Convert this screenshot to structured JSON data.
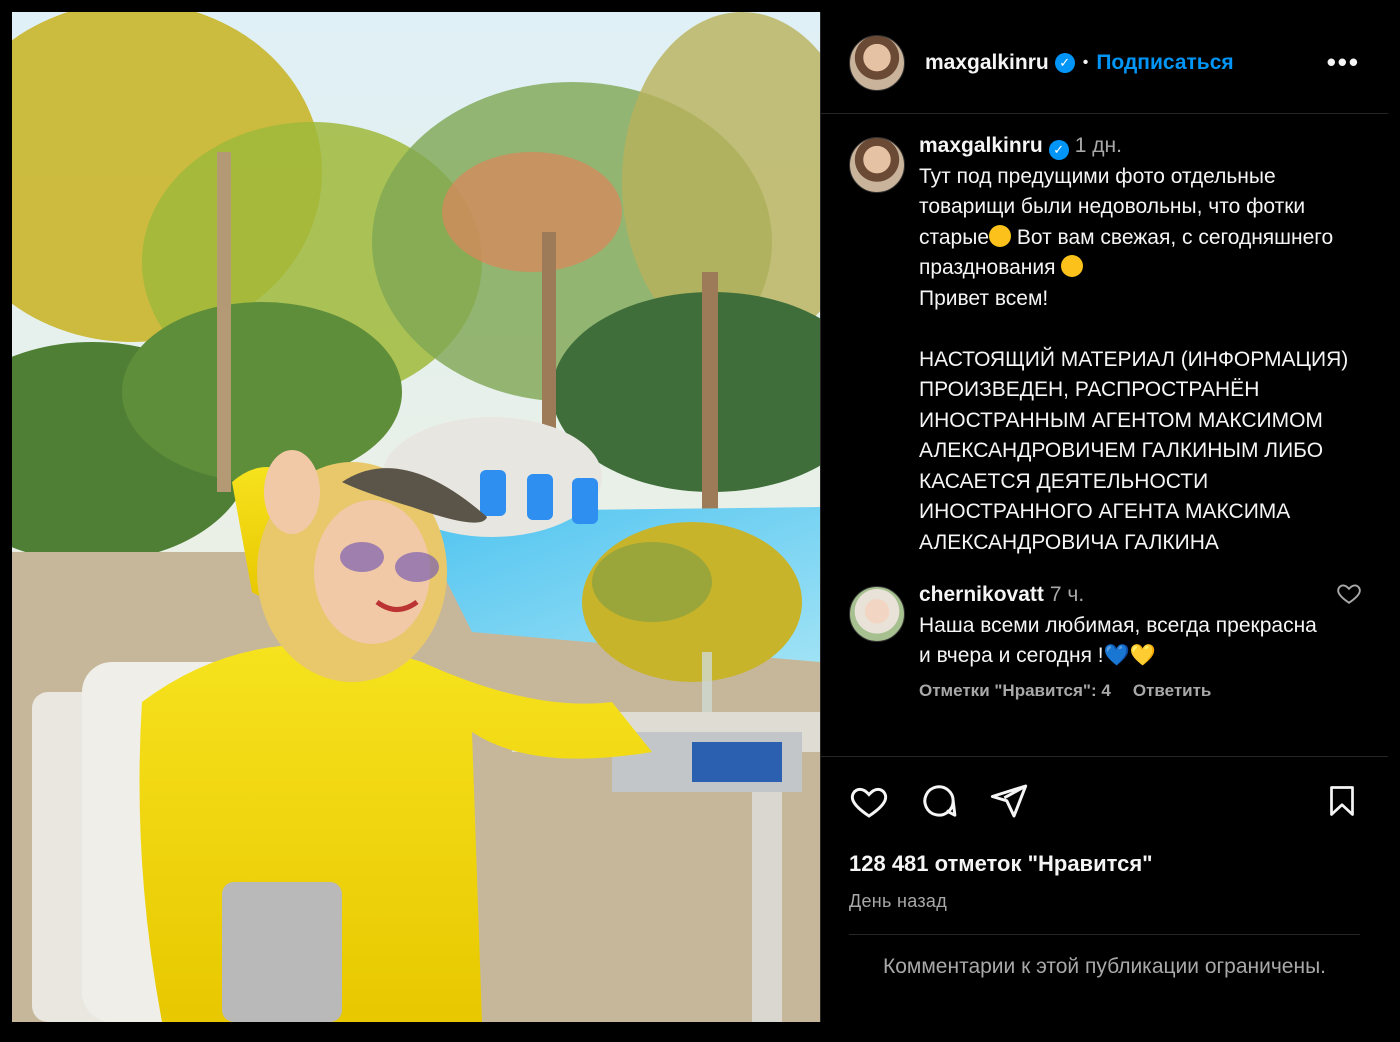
{
  "post": {
    "author": "maxgalkinru",
    "follow_label": "Подписаться",
    "dot": "•",
    "more_label": "•••"
  },
  "caption": {
    "author": "maxgalkinru",
    "time": "1 дн.",
    "text_1": "Тут под предущими фото отдельные товарищи были недовольны, что фотки старые",
    "text_2": " Вот вам свежая, с сегодняшнего празднования ",
    "text_3": "\nПривет всем!\n\nНАСТОЯЩИЙ МАТЕРИАЛ (ИНФОРМАЦИЯ) ПРОИЗВЕДЕН, РАСПРОСТРАНЁН ИНОСТРАННЫМ АГЕНТОМ МАКСИМОМ АЛЕКСАНДРОВИЧЕМ ГАЛКИНЫМ ЛИБО КАСАЕТСЯ ДЕЯТЕЛЬНОСТИ ИНОСТРАННОГО АГЕНТА МАКСИМА АЛЕКСАНДРОВИЧА ГАЛКИНА"
  },
  "comment": {
    "author": "chernikovatt",
    "time": "7 ч.",
    "text": "Наша всеми любимая, всегда прекрасна и вчера и сегодня !",
    "heart_blue": "💙",
    "heart_yellow": "💛",
    "likes": "Отметки \"Нравится\": 4",
    "reply": "Ответить"
  },
  "actions": {
    "likes_count": "128 481 отметок \"Нравится\"",
    "posted": "День назад"
  },
  "restricted_text": "Комментарии к этой публикации ограничены.",
  "colors": {
    "link": "#0095f6",
    "secondary": "#a8a8a8",
    "divider": "#262626"
  },
  "icons": [
    "verified-icon",
    "more-icon",
    "heart-icon",
    "comment-icon",
    "share-icon",
    "bookmark-icon"
  ]
}
